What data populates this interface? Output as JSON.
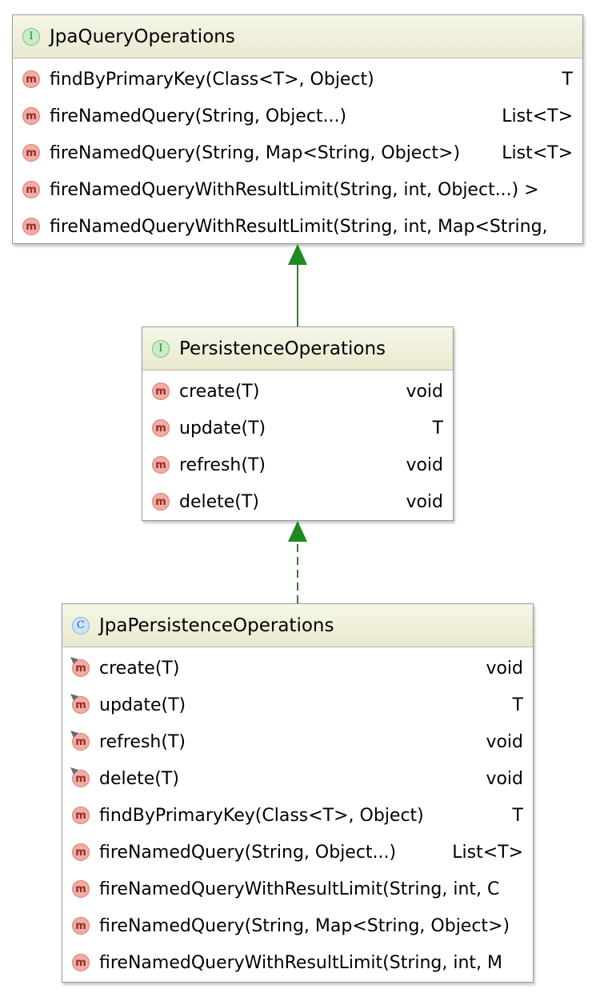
{
  "diagram": {
    "boxes": [
      {
        "kind": "I",
        "name": "JpaQueryOperations",
        "methods": [
          {
            "signature": "findByPrimaryKey(Class<T>, Object)",
            "returns": "T"
          },
          {
            "signature": "fireNamedQuery(String, Object...)",
            "returns": "List<T>"
          },
          {
            "signature": "fireNamedQuery(String, Map<String, Object>)",
            "returns": "List<T>"
          },
          {
            "signature": "fireNamedQueryWithResultLimit(String, int, Object...) >",
            "returns": ""
          },
          {
            "signature": "fireNamedQueryWithResultLimit(String, int, Map<String,",
            "returns": ""
          }
        ]
      },
      {
        "kind": "I",
        "name": "PersistenceOperations",
        "methods": [
          {
            "signature": "create(T)",
            "returns": "void"
          },
          {
            "signature": "update(T)",
            "returns": "T"
          },
          {
            "signature": "refresh(T)",
            "returns": "void"
          },
          {
            "signature": "delete(T)",
            "returns": "void"
          }
        ]
      },
      {
        "kind": "C",
        "name": "JpaPersistenceOperations",
        "methods": [
          {
            "signature": "create(T)",
            "returns": "void",
            "overrides": true
          },
          {
            "signature": "update(T)",
            "returns": "T",
            "overrides": true
          },
          {
            "signature": "refresh(T)",
            "returns": "void",
            "overrides": true
          },
          {
            "signature": "delete(T)",
            "returns": "void",
            "overrides": true
          },
          {
            "signature": "findByPrimaryKey(Class<T>, Object)",
            "returns": "T"
          },
          {
            "signature": "fireNamedQuery(String, Object...)",
            "returns": "List<T>"
          },
          {
            "signature": "fireNamedQueryWithResultLimit(String, int, C",
            "returns": ""
          },
          {
            "signature": "fireNamedQuery(String, Map<String, Object>)",
            "returns": ""
          },
          {
            "signature": "fireNamedQueryWithResultLimit(String, int, M",
            "returns": ""
          }
        ]
      }
    ],
    "method_badge": "m",
    "relations": [
      {
        "from": "PersistenceOperations",
        "to": "JpaQueryOperations",
        "type": "extends",
        "style": "solid"
      },
      {
        "from": "JpaPersistenceOperations",
        "to": "PersistenceOperations",
        "type": "implements",
        "style": "dashed"
      }
    ],
    "colors": {
      "arrow": "#1f8a1f",
      "interface_badge": "#c9ecc9",
      "class_badge": "#cde3f6",
      "method_badge": "#f3aca4",
      "header": "#eeeed8"
    }
  }
}
